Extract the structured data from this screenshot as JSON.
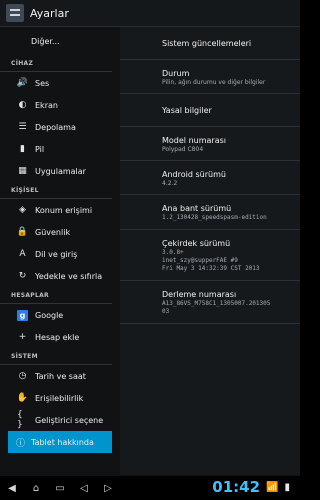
{
  "app": {
    "title": "Ayarlar"
  },
  "sidebar": {
    "top_item": "Diğer...",
    "sections": [
      {
        "header": "CİHAZ",
        "items": [
          {
            "icon": "volume-icon",
            "label": "Ses"
          },
          {
            "icon": "brightness-icon",
            "label": "Ekran"
          },
          {
            "icon": "storage-icon",
            "label": "Depolama"
          },
          {
            "icon": "battery-icon",
            "label": "Pil"
          },
          {
            "icon": "apps-icon",
            "label": "Uygulamalar"
          }
        ]
      },
      {
        "header": "KİŞİSEL",
        "items": [
          {
            "icon": "location-icon",
            "label": "Konum erişimi"
          },
          {
            "icon": "lock-icon",
            "label": "Güvenlik"
          },
          {
            "icon": "language-icon",
            "label": "Dil ve giriş"
          },
          {
            "icon": "backup-icon",
            "label": "Yedekle ve sıfırla"
          }
        ]
      },
      {
        "header": "HESAPLAR",
        "items": [
          {
            "icon": "google-icon",
            "label": "Google"
          },
          {
            "icon": "add-icon",
            "label": "Hesap ekle"
          }
        ]
      },
      {
        "header": "SİSTEM",
        "items": [
          {
            "icon": "clock-icon",
            "label": "Tarih ve saat"
          },
          {
            "icon": "accessibility-icon",
            "label": "Erişilebilirlik"
          },
          {
            "icon": "developer-icon",
            "label": "Geliştirici seçene"
          }
        ]
      }
    ],
    "selected_item": "Tablet hakkında"
  },
  "about": {
    "system_updates": "Sistem güncellemeleri",
    "status_title": "Durum",
    "status_sub": "Pilin, ağın durumu ve diğer bilgiler",
    "legal": "Yasal bilgiler",
    "model_title": "Model numarası",
    "model_value": "Polypad C804",
    "android_title": "Android sürümü",
    "android_value": "4.2.2",
    "baseband_title": "Ana bant sürümü",
    "baseband_value": "1.2_130428_speedspasm-edition",
    "kernel_title": "Çekirdek sürümü",
    "kernel_value": "3.0.8+\ninet_szy@supperFAE #9\nFri May 3 14:32:39 CST 2013",
    "build_title": "Derleme numarası",
    "build_value": "A13_86VS_M758C1_1305007.201305\n03"
  },
  "status_bar": {
    "time": "01:42"
  },
  "colors": {
    "accent": "#0094ce",
    "clock": "#3fc0ff"
  }
}
